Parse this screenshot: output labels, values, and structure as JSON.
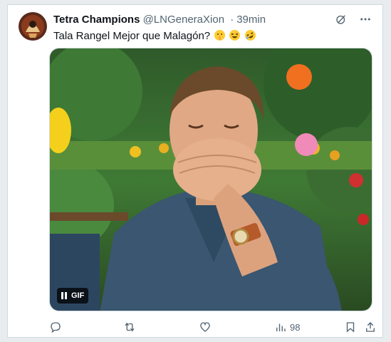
{
  "tweet": {
    "author_name": "Tetra Champions",
    "author_handle": "@LNGeneraXion",
    "separator": "·",
    "time": "39min",
    "text": "Tala Rangel Mejor que Malagón?",
    "emojis": [
      "shushing-face",
      "grinning-squinting-face",
      "rolling-on-floor-laughing-face"
    ]
  },
  "media": {
    "type": "gif",
    "badge_label": "GIF",
    "playing": true
  },
  "actions": {
    "reply_count": "",
    "retweet_count": "",
    "like_count": "",
    "views_count": "98"
  },
  "colors": {
    "text_primary": "#0f1419",
    "text_secondary": "#536471",
    "border": "#cfd9de",
    "background": "#ffffff"
  }
}
